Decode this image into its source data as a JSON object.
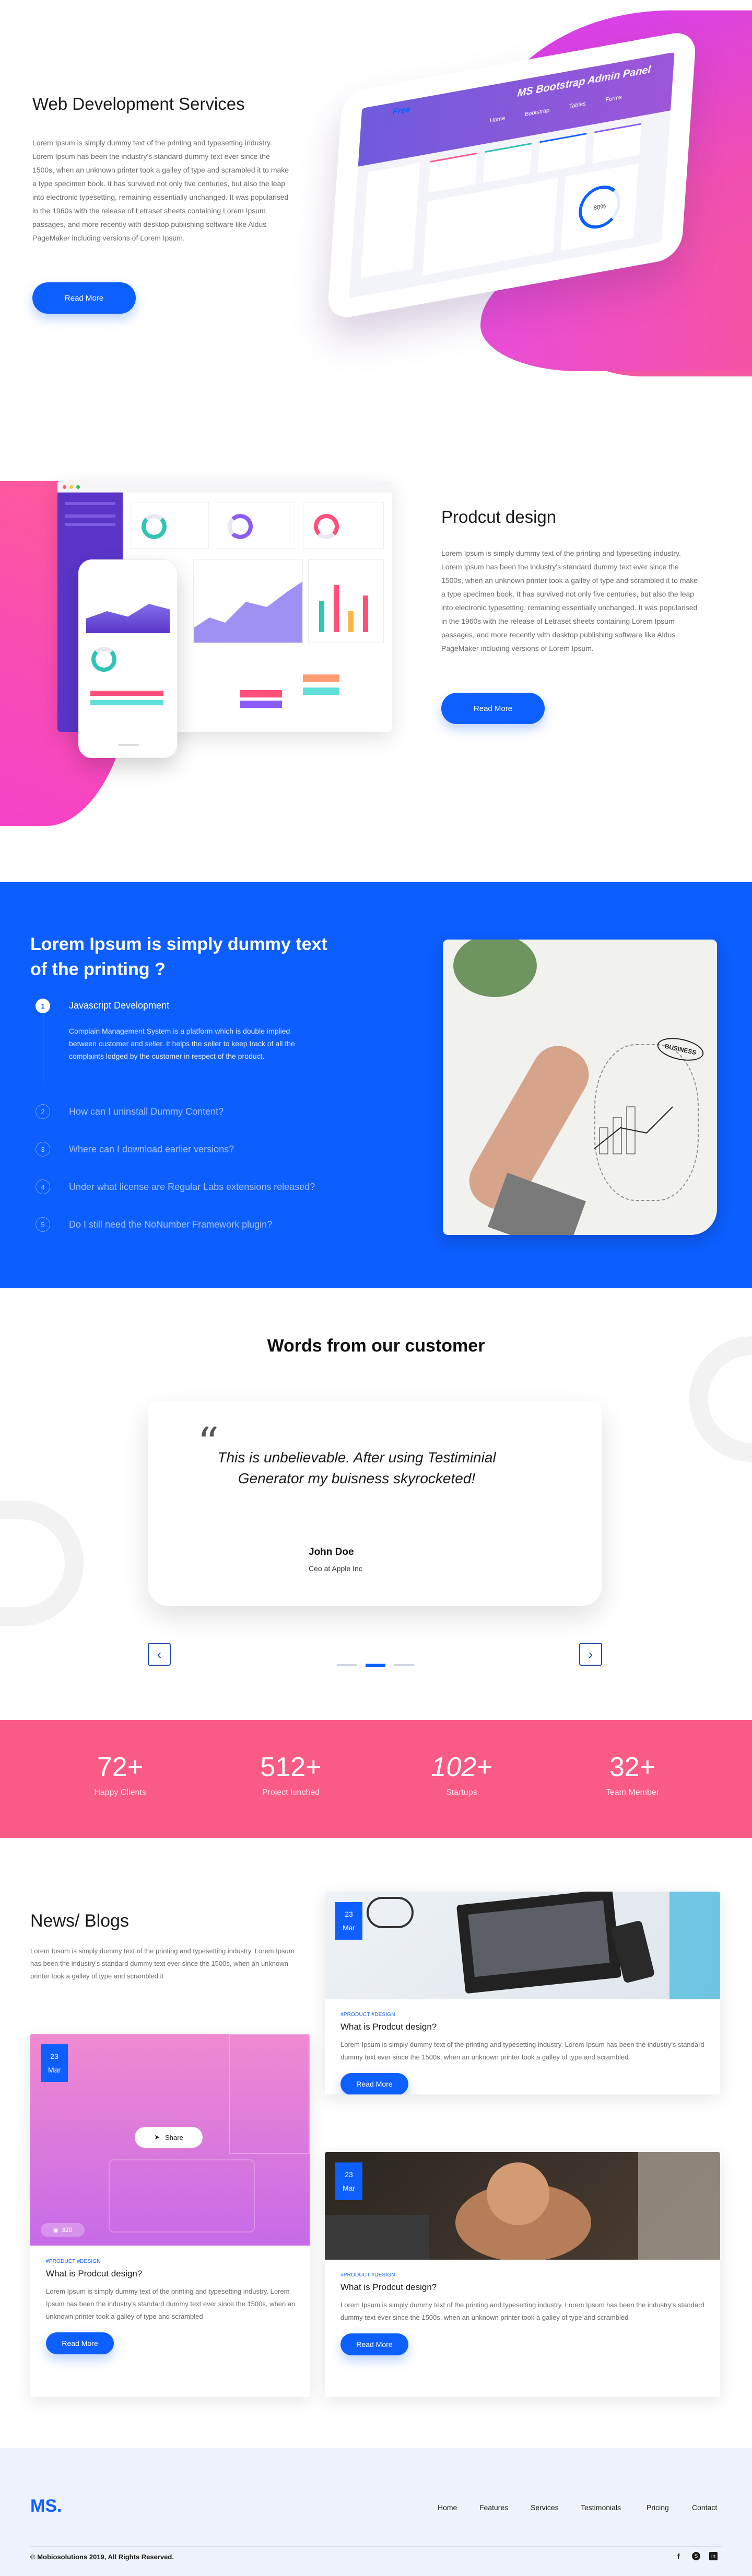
{
  "hero": {
    "title": "Web Development Services",
    "body": "Lorem Ipsum is simply dummy text of the printing and typesetting industry. Lorem Ipsum has been the industry's standard dummy text ever since the 1500s, when an unknown printer took a galley of type and scrambled it to make a type specimen book. It has survived not only five centuries, but also the leap into electronic typesetting, remaining essentially unchanged. It was popularised in the 1960s with the release of Letraset sheets containing Lorem Ipsum passages, and more recently with desktop publishing software like Aldus PageMaker including versions of Lorem Ipsum.",
    "button": "Read More",
    "tablet_badge": "Free",
    "tablet_title": "MS Bootstrap Admin Panel",
    "tablet_nav": [
      "Home",
      "Bootstrap",
      "Tables",
      "Forms"
    ],
    "tablet_gauge": "80%"
  },
  "product": {
    "title": "Prodcut design",
    "body": "Lorem Ipsum is simply dummy text of the printing and typesetting industry. Lorem Ipsum has been the industry's standard dummy text ever since the 1500s, when an unknown printer took a galley of type and scrambled it to make a type specimen book. It has survived not only five centuries, but also the leap into electronic typesetting, remaining essentially unchanged. It was popularised in the 1960s with the release of Letraset sheets containing Lorem Ipsum passages, and more recently with desktop publishing software like Aldus PageMaker including versions of Lorem Ipsum.",
    "button": "Read More"
  },
  "faq": {
    "title": "Lorem Ipsum is simply dummy text of the printing ?",
    "items": [
      {
        "num": "1",
        "q": "Javascript Development",
        "a": "Complain Management System is a platform which is double implied between customer and seller. It helps the seller to keep track of all the complaints lodged by the customer in respect of the product."
      },
      {
        "num": "2",
        "q": "How can I uninstall Dummy Content?"
      },
      {
        "num": "3",
        "q": "Where can I download earlier versions?"
      },
      {
        "num": "4",
        "q": "Under what license are Regular Labs extensions released?"
      },
      {
        "num": "5",
        "q": "Do I still need the NoNumber Framework plugin?"
      }
    ],
    "image_label": "BUSINESS"
  },
  "testimonial": {
    "heading": "Words from our customer",
    "quote_mark": "“",
    "quote": "This is unbelievable. After using Testiminial Generator my buisness skyrocketed!",
    "name": "John Doe",
    "role": "Ceo at Apple Inc",
    "prev": "‹",
    "next": "›",
    "active_dot": 2
  },
  "stats": [
    {
      "value": "72+",
      "label": "Happy Clients"
    },
    {
      "value": "512+",
      "label": "Project lunched"
    },
    {
      "value": "102+",
      "label": "Startups"
    },
    {
      "value": "32+",
      "label": "Team Member"
    }
  ],
  "news": {
    "title": "News/ Blogs",
    "intro": "Lorem Ipsum is simply dummy text of the printing and typesetting industry. Lorem Ipsum has been the industry's standard dummy text ever since the 1500s, when an unknown printer took a galley of type and scrambled it",
    "cards": [
      {
        "day": "23",
        "month": "Mar",
        "tag": "#PRODUCT #DESIGN",
        "title": "What is Prodcut design?",
        "text": "Lorem Ipsum is simply dummy text of the printing and typesetting industry. Lorem Ipsum has been the industry's standard dummy text ever since the 1500s, when an unknown printer took a galley of type and scrambled",
        "button": "Read More"
      },
      {
        "day": "23",
        "month": "Mar",
        "tag": "#PRODUCT #DESIGN",
        "title": "What is Prodcut design?",
        "text": "Lorem Ipsum is simply dummy text of the printing and typesetting industry. Lorem Ipsum has been the industry's standard dummy text ever since the 1500s, when an unknown printer took a galley of type and scrambled",
        "button": "Read More",
        "share": "Share",
        "views": "320"
      },
      {
        "day": "23",
        "month": "Mar",
        "tag": "#PRODUCT #DESIGN",
        "title": "What is Prodcut design?",
        "text": "Lorem Ipsum is simply dummy text of the printing and typesetting industry. Lorem Ipsum has been the industry's standard dummy text ever since the 1500s, when an unknown printer took a galley of type and scrambled",
        "button": "Read More"
      }
    ]
  },
  "footer": {
    "logo": "MS.",
    "nav": [
      "Home",
      "Features",
      "Services",
      "Testimonials",
      "Pricing",
      "Contact"
    ],
    "copyright": "© Mobiosolutions 2019, All Rights Reserved.",
    "social_icons": [
      "facebook-icon",
      "skype-icon",
      "linkedin-icon"
    ]
  }
}
